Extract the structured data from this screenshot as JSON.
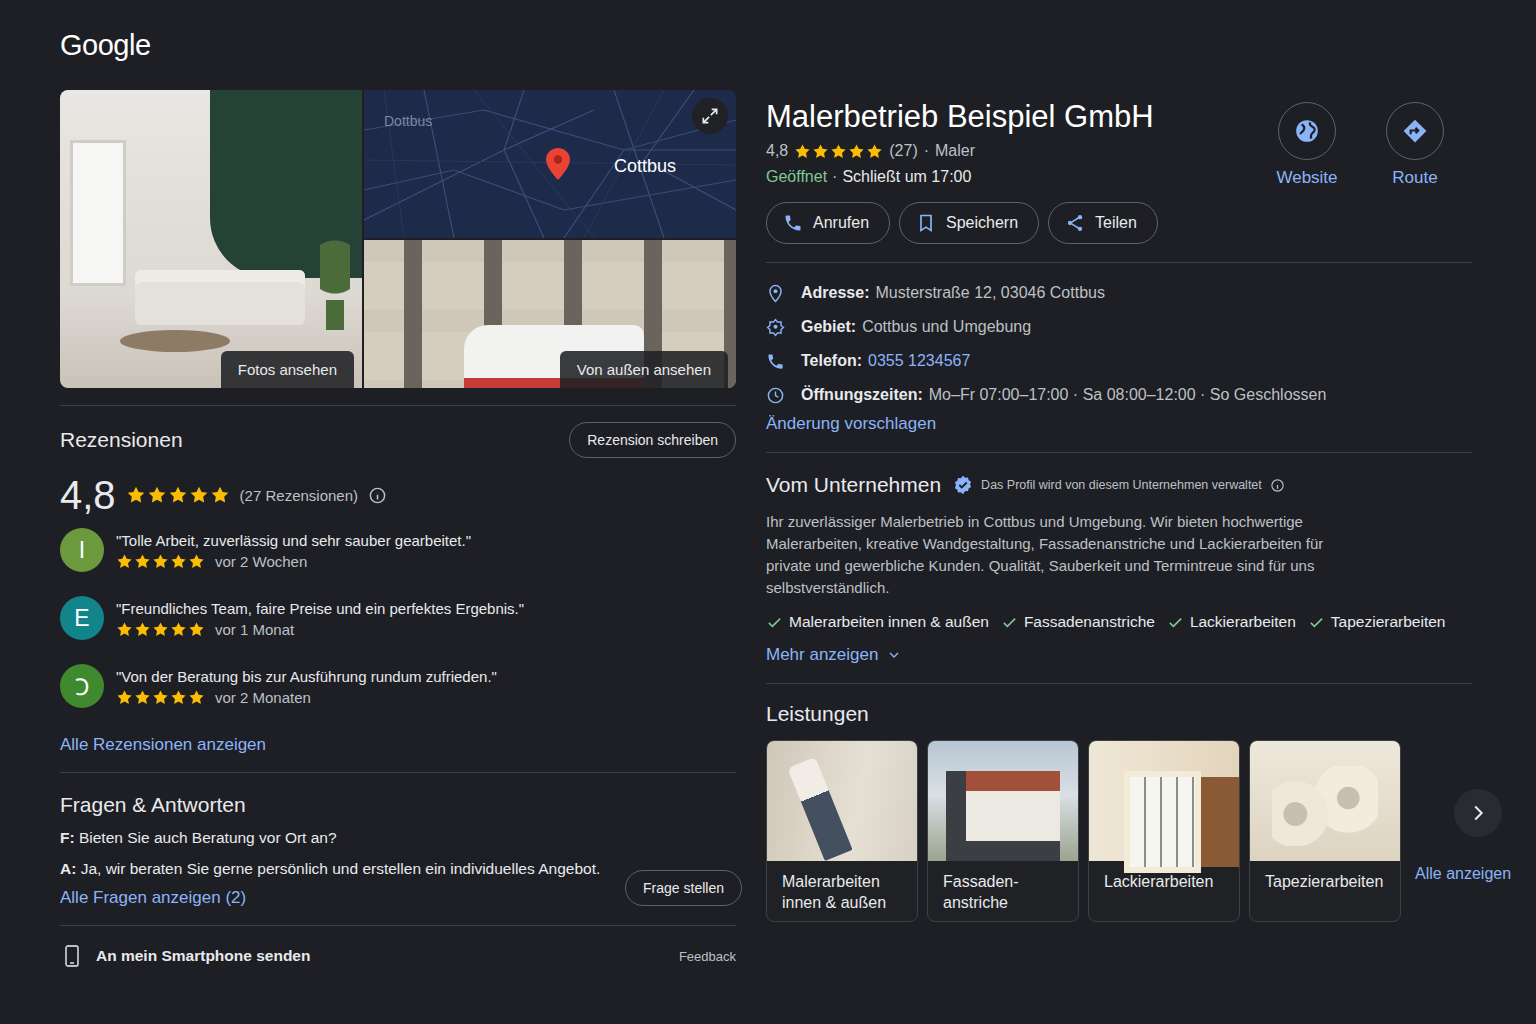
{
  "logo": "Google",
  "gallery": {
    "photos_button": "Fotos ansehen",
    "outside_button": "Von außen ansehen",
    "map": {
      "labels": [
        "Dottbus",
        "Cottbus"
      ]
    }
  },
  "reviews": {
    "title": "Rezensionen",
    "write_button": "Rezension schreiben",
    "rating": "4,8",
    "stars": 5,
    "count": "(27 Rezensionen)",
    "items": [
      {
        "initial": "I",
        "color": "#6b9a3c",
        "text": "\"Tolle Arbeit, zuverlässig und sehr sauber gearbeitet.\"",
        "stars": 5,
        "time": "vor 2 Wochen"
      },
      {
        "initial": "E",
        "color": "#11858a",
        "text": "\"Freundliches Team, faire Preise und ein perfektes Ergebnis.\"",
        "stars": 5,
        "time": "vor 1 Monat"
      },
      {
        "initial": "Ↄ",
        "color": "#3f8a2e",
        "text": "\"Von der Beratung bis zur Ausführung rundum zufrieden.\"",
        "stars": 5,
        "time": "vor 2 Monaten"
      }
    ],
    "all_link": "Alle Rezensionen anzeigen"
  },
  "qa": {
    "title": "Fragen & Antworten",
    "question_label": "F:",
    "question": "Bieten Sie auch Beratung vor Ort an?",
    "answer_label": "A:",
    "answer": "Ja, wir beraten Sie gerne persönlich und erstellen ein individuelles Angebot.",
    "all_link": "Alle Fragen anzeigen (2)",
    "ask_button": "Frage stellen"
  },
  "footer": {
    "send": "An mein Smartphone senden",
    "feedback": "Feedback"
  },
  "business": {
    "name": "Malerbetrieb Beispiel GmbH",
    "rating": "4,8",
    "stars": 5,
    "count": "(27)",
    "separator": "·",
    "category": "Maler",
    "status": "Geöffnet",
    "closes": "Schließt um 17:00"
  },
  "quick_actions": [
    {
      "label": "Website"
    },
    {
      "label": "Route"
    }
  ],
  "actions": [
    "Anrufen",
    "Speichern",
    "Teilen"
  ],
  "info": [
    {
      "label": "Adresse:",
      "value": "Musterstraße 12, 03046 Cottbus",
      "kind": "text"
    },
    {
      "label": "Gebiet:",
      "value": "Cottbus und Umgebung",
      "kind": "text"
    },
    {
      "label": "Telefon:",
      "value": "0355 1234567",
      "kind": "link"
    },
    {
      "label": "Öffnungszeiten:",
      "value": "Mo–Fr 07:00–17:00 · Sa 08:00–12:00 · So Geschlossen",
      "kind": "text"
    }
  ],
  "suggest_link": "Änderung vorschlagen",
  "about": {
    "title": "Vom Unternehmen",
    "verified_note": "Das Profil wird von diesem Unternehmen verwaltet",
    "description": "Ihr zuverlässiger Malerbetrieb in Cottbus und Umgebung. Wir bieten hochwertige Malerarbeiten, kreative Wandgestaltung, Fassadenanstriche und Lackierarbeiten für private und gewerbliche Kunden. Qualität, Sauberkeit und Termintreue sind für uns selbstverständlich.",
    "features": [
      "Malerarbeiten innen & außen",
      "Fassadenanstriche",
      "Lackierarbeiten",
      "Tapezierarbeiten"
    ],
    "more": "Mehr anzeigen"
  },
  "services": {
    "title": "Leistungen",
    "items": [
      {
        "label": "Malerarbeiten innen & außen"
      },
      {
        "label": "Fassaden-anstriche"
      },
      {
        "label": "Lackierarbeiten"
      },
      {
        "label": "Tapezierarbeiten"
      }
    ],
    "all_link": "Alle anzeigen"
  }
}
